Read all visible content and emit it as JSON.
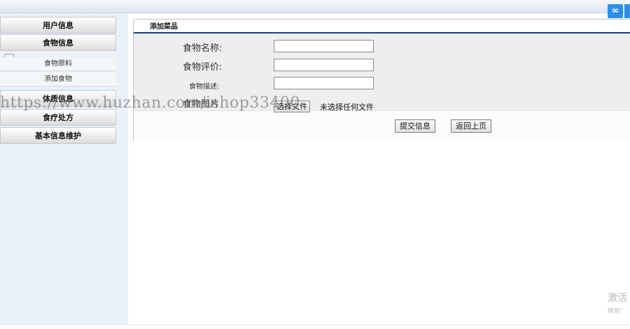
{
  "sidebar": {
    "heads": [
      "用户信息",
      "食物信息",
      "体质信息",
      "食疗处方",
      "基本信息维护"
    ],
    "subs": [
      "食物原料",
      "添加食物"
    ]
  },
  "panel": {
    "title": "添加菜品",
    "fields": {
      "name_label": "食物名称:",
      "review_label": "食物评价:",
      "desc_label": "食物描述:",
      "image_label": "食物图片"
    },
    "file": {
      "button": "选择文件",
      "status": "未选择任何文件"
    },
    "buttons": {
      "submit": "提交信息",
      "back": "返回上页"
    }
  },
  "overlay": {
    "watermark": "https://www.huzhan.com/ishop33400",
    "activate_line1": "激活",
    "activate_line2": "转到\""
  },
  "icons": {
    "cloud": "cloud-sync-icon"
  },
  "colors": {
    "accent": "#2d8ee6",
    "title_underline": "#1c3f6e"
  }
}
